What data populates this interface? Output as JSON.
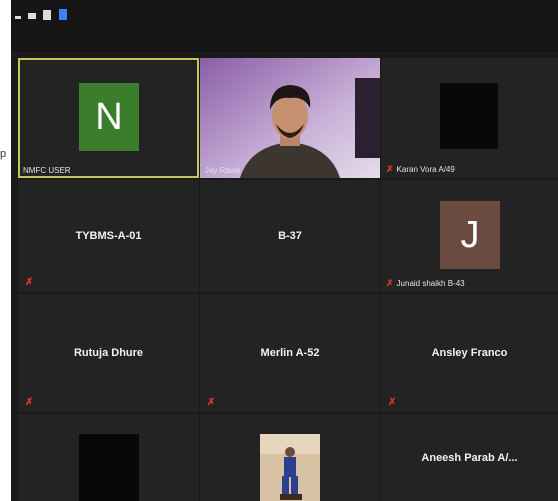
{
  "edge_label": "p",
  "colors": {
    "window_bg": "#1a1a1a",
    "tile_bg": "#232323",
    "active_border": "#c8c65a",
    "muted_red": "#e0362a",
    "avatar_n": "#3a7d2c",
    "avatar_j": "#6b4a3f"
  },
  "tiles": [
    {
      "caption": "NMFC USER",
      "avatar_letter": "N",
      "muted": false,
      "active": true
    },
    {
      "caption": "Jay Raval",
      "muted": false,
      "video": true
    },
    {
      "caption": "Karan Vora A/49",
      "muted": true
    },
    {
      "center_name": "TYBMS-A-01",
      "muted": true
    },
    {
      "center_name": "B-37",
      "muted": false
    },
    {
      "caption": "Junaid shaikh B-43",
      "avatar_letter": "J",
      "muted": true
    },
    {
      "center_name": "Rutuja Dhure",
      "muted": true
    },
    {
      "center_name": "Merlin A-52",
      "muted": true
    },
    {
      "center_name": "Ansley Franco",
      "muted": true
    },
    {
      "muted": false
    },
    {
      "muted": false,
      "video": true
    },
    {
      "center_name": "Aneesh Parab A/..."
    }
  ]
}
